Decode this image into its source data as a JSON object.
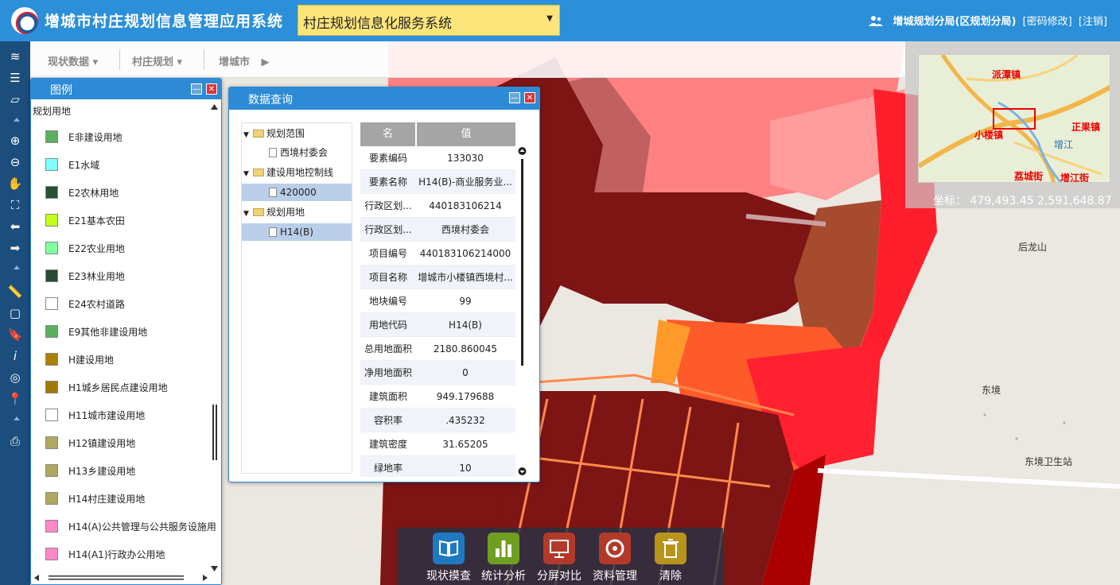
{
  "header": {
    "app_title": "增城市村庄规划信息管理应用系统",
    "system_select": "村庄规划信息化服务系统",
    "user_name": "增城规划分局(区规划分局)",
    "change_password": "[密码修改]",
    "logout": "[注销]"
  },
  "colors": {
    "header_bg": "#2b8fd9",
    "select_bg": "#fde57a",
    "toolbar_bg": "#1c4e7d",
    "panel_head": "#2d8ad6"
  },
  "navbar": {
    "items": [
      "现状数据",
      "村庄规划",
      "增城市"
    ]
  },
  "toolbar_icons": [
    "layers-icon",
    "list-icon",
    "eraser-icon",
    "zoom-in-icon",
    "zoom-out-icon",
    "pan-hand-icon",
    "full-extent-icon",
    "back-arrow-icon",
    "forward-arrow-icon",
    "measure-ruler-icon",
    "select-box-icon",
    "bookmark-icon",
    "info-icon",
    "locate-icon",
    "pin-icon",
    "print-icon"
  ],
  "legend": {
    "title": "图例",
    "group": "规划用地",
    "items": [
      {
        "label": "E非建设用地",
        "color": "#5caf5f"
      },
      {
        "label": "E1水域",
        "color": "#80ffff"
      },
      {
        "label": "E2农林用地",
        "color": "#275232"
      },
      {
        "label": "E21基本农田",
        "color": "#c4ff1a"
      },
      {
        "label": "E22农业用地",
        "color": "#80ff9e"
      },
      {
        "label": "E23林业用地",
        "color": "#2b4a33"
      },
      {
        "label": "E24农村道路",
        "color": "#ffffff"
      },
      {
        "label": "E9其他非建设用地",
        "color": "#5caf5f"
      },
      {
        "label": "H建设用地",
        "color": "#a88200"
      },
      {
        "label": "H1城乡居民点建设用地",
        "color": "#a37a00"
      },
      {
        "label": "H11城市建设用地",
        "color": "#ffffff"
      },
      {
        "label": "H12镇建设用地",
        "color": "#b0a860"
      },
      {
        "label": "H13乡建设用地",
        "color": "#b0a860"
      },
      {
        "label": "H14村庄建设用地",
        "color": "#b0a860"
      },
      {
        "label": "H14(A)公共管理与公共服务设施用",
        "color": "#ff88c8"
      },
      {
        "label": "H14(A1)行政办公用地",
        "color": "#ff88c8"
      }
    ]
  },
  "query": {
    "title": "数据查询",
    "tree": [
      {
        "label": "规划范围",
        "type": "folder"
      },
      {
        "label": "西境村委会",
        "type": "file"
      },
      {
        "label": "建设用地控制线",
        "type": "folder"
      },
      {
        "label": "420000",
        "type": "file"
      },
      {
        "label": "规划用地",
        "type": "folder"
      },
      {
        "label": "H14(B)",
        "type": "file"
      }
    ],
    "grid_headers": {
      "name": "名",
      "value": "值"
    },
    "rows": [
      {
        "k": "要素编码",
        "v": "133030"
      },
      {
        "k": "要素名称",
        "v": "H14(B)-商业服务业..."
      },
      {
        "k": "行政区划...",
        "v": "440183106214"
      },
      {
        "k": "行政区划...",
        "v": "西境村委会"
      },
      {
        "k": "项目编号",
        "v": "440183106214000"
      },
      {
        "k": "项目名称",
        "v": "增城市小楼镇西境村..."
      },
      {
        "k": "地块编号",
        "v": "99"
      },
      {
        "k": "用地代码",
        "v": "H14(B)"
      },
      {
        "k": "总用地面积",
        "v": "2180.860045"
      },
      {
        "k": "净用地面积",
        "v": "0"
      },
      {
        "k": "建筑面积",
        "v": "949.179688"
      },
      {
        "k": "容积率",
        "v": ".435232"
      },
      {
        "k": "建筑密度",
        "v": "31.65205"
      },
      {
        "k": "绿地率",
        "v": "10"
      }
    ]
  },
  "minimap": {
    "places": [
      "派潭镇",
      "小楼镇",
      "正果镇",
      "增江",
      "荔城街",
      "增江街"
    ],
    "coord_label": "坐标：",
    "coord_value": "479,493.45 2,591,648.87"
  },
  "map_labels": [
    "后龙山",
    "东境",
    "东境卫生站"
  ],
  "bottom_tools": [
    {
      "label": "现状摸查",
      "color": "#1f78c2"
    },
    {
      "label": "统计分析",
      "color": "#6f9e23"
    },
    {
      "label": "分屏对比",
      "color": "#b23a2a"
    },
    {
      "label": "资料管理",
      "color": "#b23a2a"
    },
    {
      "label": "清除",
      "color": "#b8951a"
    }
  ]
}
